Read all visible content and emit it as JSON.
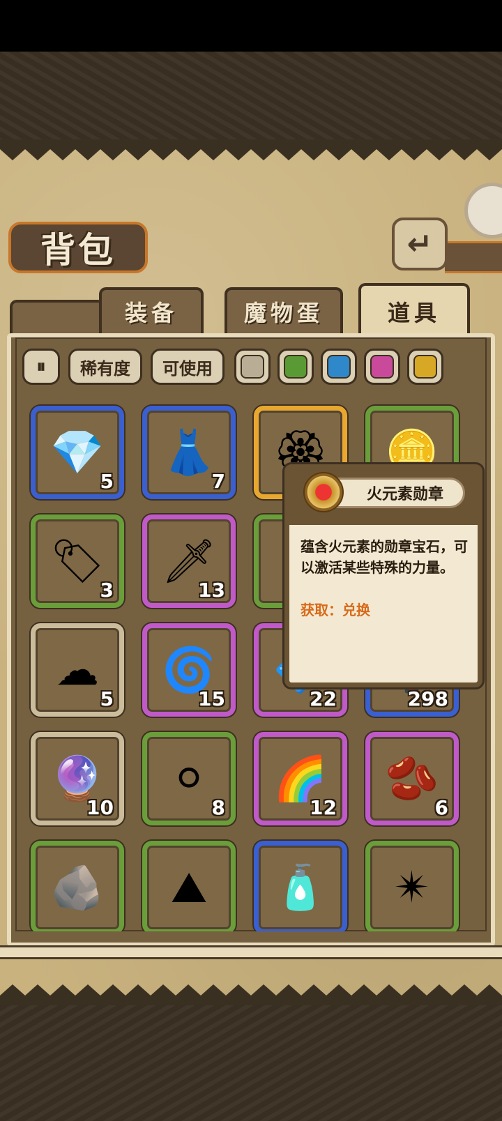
{
  "header": {
    "title": "背包"
  },
  "tabs": [
    {
      "label": "装备",
      "active": false
    },
    {
      "label": "魔物蛋",
      "active": false
    },
    {
      "label": "道具",
      "active": true
    }
  ],
  "filters": {
    "toggle_icon": "sort-toggle-icon",
    "rarity_label": "稀有度",
    "usable_label": "可使用",
    "swatch_colors": [
      "#b9ad96",
      "#5a9a34",
      "#2f88c9",
      "#c94a9a",
      "#d6a826"
    ]
  },
  "rarity_colors": {
    "gray": "#cbbd9c",
    "green": "#6a9e3a",
    "blue": "#3a5fd0",
    "purple": "#c05ac8",
    "gold": "#e8a830"
  },
  "items": [
    {
      "name": "crystal",
      "icon": "💎",
      "count": "5",
      "rarity": "blue"
    },
    {
      "name": "rainbow-dress",
      "icon": "👗",
      "count": "7",
      "rarity": "blue"
    },
    {
      "name": "fire-medal",
      "icon": "🏵",
      "count": "",
      "rarity": "gold"
    },
    {
      "name": "star-coin",
      "icon": "🪙",
      "count": "",
      "rarity": "green"
    },
    {
      "name": "charm-tag",
      "icon": "🏷",
      "count": "3",
      "rarity": "green"
    },
    {
      "name": "dark-sword",
      "icon": "🗡",
      "count": "13",
      "rarity": "purple"
    },
    {
      "name": "hidden-item",
      "icon": "",
      "count": "",
      "rarity": "green"
    },
    {
      "name": "hidden-item-2",
      "icon": "",
      "count": "",
      "rarity": "blue"
    },
    {
      "name": "cloud",
      "icon": "☁",
      "count": "5",
      "rarity": "gray"
    },
    {
      "name": "vortex",
      "icon": "🌀",
      "count": "15",
      "rarity": "purple"
    },
    {
      "name": "blue-gem-shard",
      "icon": "🔷",
      "count": "22",
      "rarity": "purple"
    },
    {
      "name": "lantern",
      "icon": "🏮",
      "count": "298",
      "rarity": "blue"
    },
    {
      "name": "rainbow-orb",
      "icon": "🔮",
      "count": "10",
      "rarity": "gray"
    },
    {
      "name": "fur-ball",
      "icon": "⚪",
      "count": "8",
      "rarity": "green"
    },
    {
      "name": "rainbow-fluff",
      "icon": "🌈",
      "count": "12",
      "rarity": "purple"
    },
    {
      "name": "cocoa-pod",
      "icon": "🫘",
      "count": "6",
      "rarity": "purple"
    },
    {
      "name": "ore-pile",
      "icon": "🪨",
      "count": "",
      "rarity": "green"
    },
    {
      "name": "sand-pile",
      "icon": "⛰",
      "count": "",
      "rarity": "green"
    },
    {
      "name": "potion-jar",
      "icon": "🧴",
      "count": "",
      "rarity": "blue"
    },
    {
      "name": "star-flower",
      "icon": "✴",
      "count": "",
      "rarity": "green"
    }
  ],
  "tooltip": {
    "name": "火元素勋章",
    "icon": "fire-medal-icon",
    "description": "蕴含火元素的勋章宝石，可以激活某些特殊的力量。",
    "source": "获取：兑换"
  },
  "back_button": {
    "icon": "back-arrow-icon",
    "label": "↵"
  }
}
